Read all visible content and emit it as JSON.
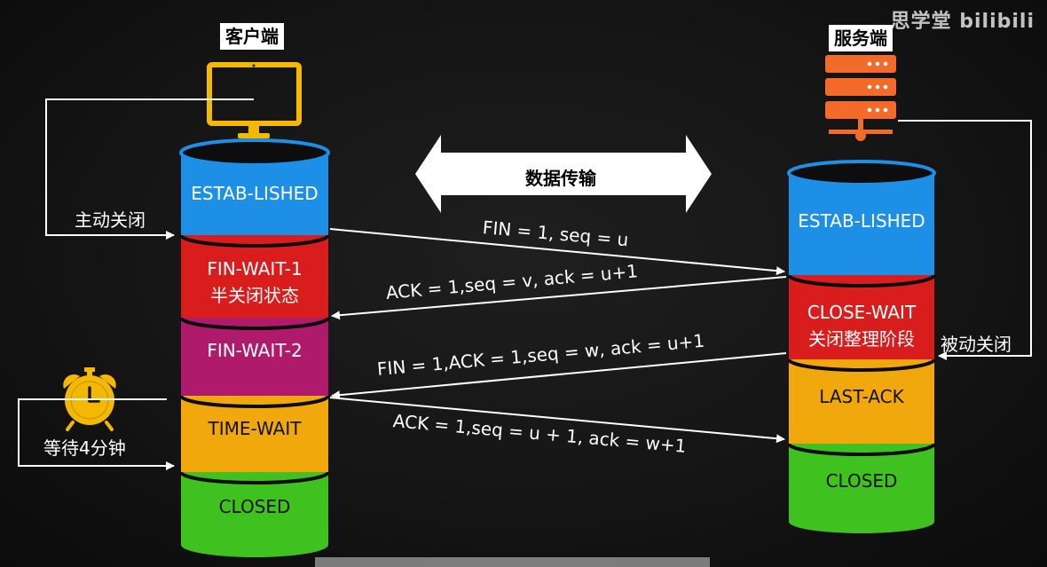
{
  "client": {
    "title": "客户端",
    "states": [
      "ESTAB-LISHED",
      "FIN-WAIT-1",
      "半关闭状态",
      "FIN-WAIT-2",
      "TIME-WAIT",
      "CLOSED"
    ],
    "active_close": "主动关闭",
    "wait_label": "等待4分钟"
  },
  "server": {
    "title": "服务端",
    "states": [
      "ESTAB-LISHED",
      "CLOSE-WAIT",
      "关闭整理阶段",
      "LAST-ACK",
      "CLOSED"
    ],
    "passive_close": "被动关闭"
  },
  "data_transfer": "数据传输",
  "messages": [
    "FIN = 1, seq = u",
    "ACK = 1,seq = v, ack = u+1",
    "FIN = 1,ACK = 1,seq = w, ack = u+1",
    "ACK = 1,seq = u + 1, ack = w+1"
  ],
  "watermark": "思学堂 bilibili",
  "colors": {
    "established": "#1e8fe6",
    "fin_wait_1": "#d91c1c",
    "fin_wait_2": "#b01a6a",
    "time_wait": "#f0a80d",
    "closed": "#3fc21f",
    "icon_yellow": "#f5b800",
    "icon_orange": "#f26b2a"
  }
}
